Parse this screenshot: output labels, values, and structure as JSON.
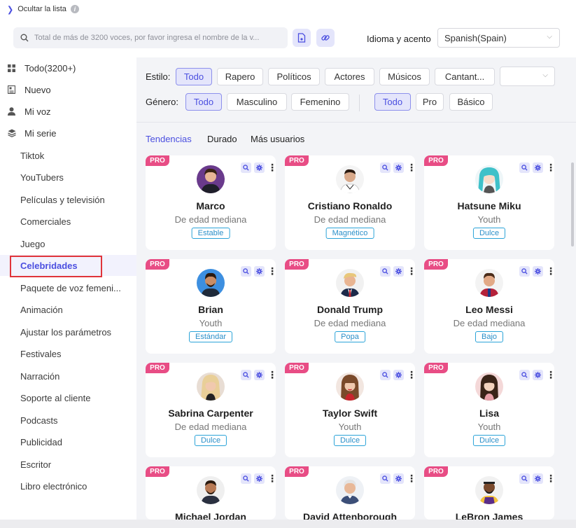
{
  "toggle": {
    "label": "Ocultar la lista"
  },
  "search": {
    "placeholder": "Total de más de 3200 voces, por favor ingresa el nombre de la v..."
  },
  "language": {
    "label": "Idioma y acento",
    "value": "Spanish(Spain)"
  },
  "sidebar": {
    "top_items": [
      {
        "label": "Todo(3200+)",
        "icon": "grid-icon"
      },
      {
        "label": "Nuevo",
        "icon": "news-icon"
      },
      {
        "label": "Mi voz",
        "icon": "user-icon"
      },
      {
        "label": "Mi serie",
        "icon": "layers-icon"
      }
    ],
    "sub_items": [
      "Tiktok",
      "YouTubers",
      "Películas y televisión",
      "Comerciales",
      "Juego",
      "Celebridades",
      "Paquete de voz femeni...",
      "Animación",
      "Ajustar los parámetros",
      "Festivales",
      "Narración",
      "Soporte al cliente",
      "Podcasts",
      "Publicidad",
      "Escritor",
      "Libro electrónico"
    ],
    "active": "Celebridades"
  },
  "filters": {
    "style_label": "Estilo:",
    "styles": [
      "Todo",
      "Rapero",
      "Políticos",
      "Actores",
      "Músicos",
      "Cantant..."
    ],
    "gender_label": "Género:",
    "genders": [
      "Todo",
      "Masculino",
      "Femenino"
    ],
    "tiers": [
      "Todo",
      "Pro",
      "Básico"
    ]
  },
  "sort": {
    "options": [
      "Tendencias",
      "Durado",
      "Más usuarios"
    ],
    "selected": "Tendencias"
  },
  "badge": "PRO",
  "voices": [
    {
      "name": "Marco",
      "age": "De edad mediana",
      "tag": "Estable"
    },
    {
      "name": "Cristiano Ronaldo",
      "age": "De edad mediana",
      "tag": "Magnético"
    },
    {
      "name": "Hatsune Miku",
      "age": "Youth",
      "tag": "Dulce"
    },
    {
      "name": "Brian",
      "age": "Youth",
      "tag": "Estándar"
    },
    {
      "name": "Donald Trump",
      "age": "De edad mediana",
      "tag": "Popa"
    },
    {
      "name": "Leo Messi",
      "age": "De edad mediana",
      "tag": "Bajo"
    },
    {
      "name": "Sabrina Carpenter",
      "age": "De edad mediana",
      "tag": "Dulce"
    },
    {
      "name": "Taylor Swift",
      "age": "Youth",
      "tag": "Dulce"
    },
    {
      "name": "Lisa",
      "age": "Youth",
      "tag": "Dulce"
    },
    {
      "name": "Michael Jordan",
      "age": "",
      "tag": ""
    },
    {
      "name": "David Attenborough",
      "age": "",
      "tag": ""
    },
    {
      "name": "LeBron James",
      "age": "",
      "tag": ""
    }
  ],
  "colors": {
    "accent": "#4b4fe0",
    "pro_badge": "#e84d85",
    "tag_border": "#2aa3d8",
    "highlight": "#e0343a"
  }
}
